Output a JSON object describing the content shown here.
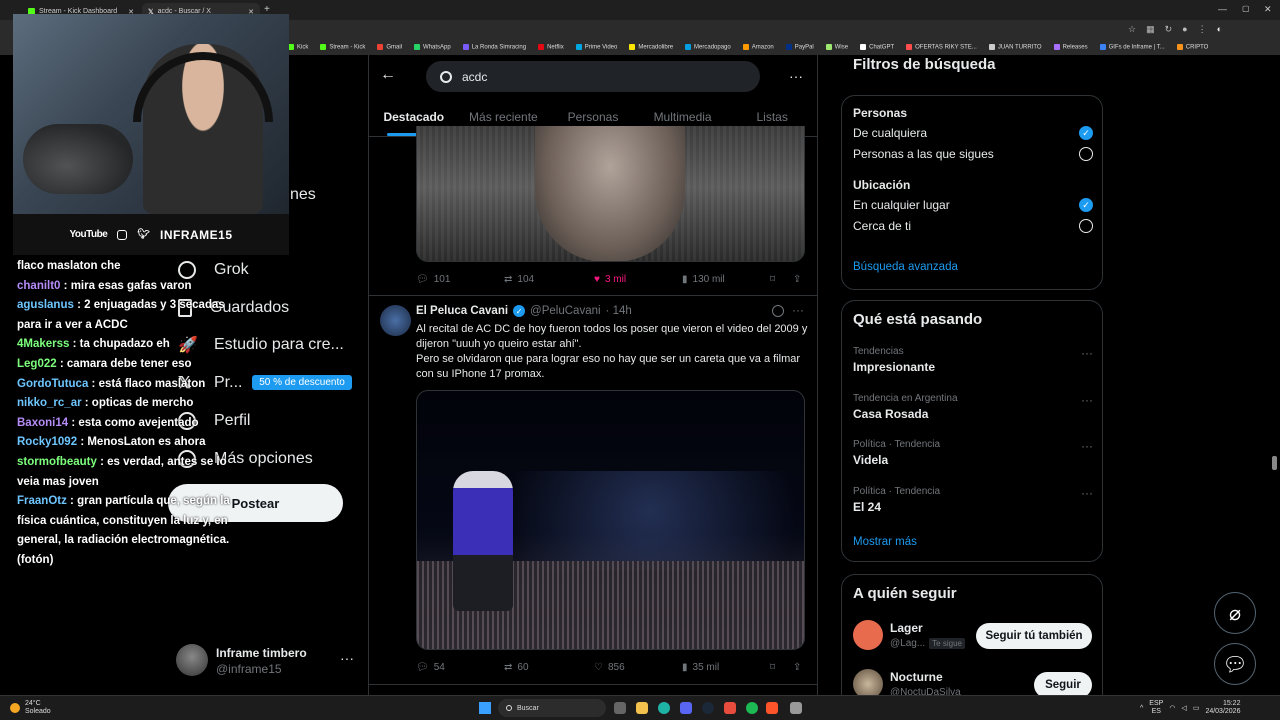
{
  "browser": {
    "tabs": [
      {
        "label": "Stream - Kick Dashboard",
        "icon": "kick-icon"
      },
      {
        "label": "acdc - Buscar / X",
        "icon": "x-icon"
      }
    ],
    "bookmarks": [
      {
        "label": "Kick",
        "color": "#53fc18"
      },
      {
        "label": "Stream - Kick",
        "color": "#53fc18"
      },
      {
        "label": "Gmail",
        "color": "#ea4335"
      },
      {
        "label": "WhatsApp",
        "color": "#25d366"
      },
      {
        "label": "La Ronda Simracing",
        "color": "#7a5af8"
      },
      {
        "label": "Netflix",
        "color": "#e50914"
      },
      {
        "label": "Prime Video",
        "color": "#00a8e1"
      },
      {
        "label": "Mercadolibre",
        "color": "#ffe600"
      },
      {
        "label": "Mercadopago",
        "color": "#009ee3"
      },
      {
        "label": "Amazon",
        "color": "#ff9900"
      },
      {
        "label": "PayPal",
        "color": "#003087"
      },
      {
        "label": "Wise",
        "color": "#9fe870"
      },
      {
        "label": "ChatGPT",
        "color": "#ffffff"
      },
      {
        "label": "OFERTAS RIKY STE...",
        "color": "#ff4d4d"
      },
      {
        "label": "JUAN TURRITO",
        "color": "#cccccc"
      },
      {
        "label": "Releases",
        "color": "#a970ff"
      },
      {
        "label": "GIFs de Inframe | T...",
        "color": "#3b82f6"
      },
      {
        "label": "CRIPTO",
        "color": "#f7931a"
      }
    ]
  },
  "webcam": {
    "brand_youtube": "YouTube",
    "channel_name": "INFRAME15"
  },
  "chat": [
    {
      "user": "",
      "msg": "flaco maslaton che",
      "color": "#ffffff"
    },
    {
      "user": "chanilt0",
      "msg": ": mira esas gafas varon",
      "color": "#b58cf8"
    },
    {
      "user": "aguslanus",
      "msg": ": 2 enjuagadas y 3 secadas para ir a ver a ACDC",
      "color": "#6ec6ff"
    },
    {
      "user": "4Makerss",
      "msg": ": ta chupadazo eh",
      "color": "#7dff7d"
    },
    {
      "user": "Leg022",
      "msg": ": camara debe tener eso",
      "color": "#7dff7d"
    },
    {
      "user": "GordoTutuca",
      "msg": ": está flaco maslaton",
      "color": "#6ec6ff"
    },
    {
      "user": "nikko_rc_ar",
      "msg": ": opticas de mercho",
      "color": "#6ec6ff"
    },
    {
      "user": "Baxoni14",
      "msg": ": esta como avejentado",
      "color": "#b58cf8"
    },
    {
      "user": "Rocky1092",
      "msg": ": MenosLaton es ahora",
      "color": "#6ec6ff"
    },
    {
      "user": "stormofbeauty",
      "msg": ": es verdad, antes se lo veia mas joven",
      "color": "#7dff7d"
    },
    {
      "user": "FraanOtz",
      "msg": ": gran partícula que, según la física cuántica, constituyen la luz y, en general, la radiación electromagnética. (fotón)",
      "color": "#6ec6ff"
    }
  ],
  "nav": {
    "partial_label": "nes",
    "items": [
      {
        "label": "Grok",
        "icon": "grok-icon"
      },
      {
        "label": "Guardados",
        "icon": "bookmark-icon"
      },
      {
        "label": "Estudio para cre...",
        "icon": "rocket-icon"
      },
      {
        "label": "Pr...",
        "icon": "x-logo-icon"
      },
      {
        "label": "Perfil",
        "icon": "person-icon"
      },
      {
        "label": "Más opciones",
        "icon": "more-circle-icon"
      }
    ],
    "promo_badge": "50 % de descuento",
    "post_button": "Postear",
    "account_name": "Inframe timbero",
    "account_handle": "@inframe15"
  },
  "search": {
    "query": "acdc",
    "tabs": [
      "Destacado",
      "Más reciente",
      "Personas",
      "Multimedia",
      "Listas"
    ],
    "active_tab": "Destacado"
  },
  "tweet1": {
    "replies": "101",
    "retweets": "104",
    "likes": "3 mil",
    "views": "130 mil"
  },
  "tweet2": {
    "name": "El Peluca Cavani",
    "handle": "@PeluCavani",
    "time": "· 14h",
    "text": "Al recital de AC DC de hoy fueron todos los poser que vieron el video del 2009 y dijeron \"uuuh yo queiro estar ahí\".\nPero se olvidaron que para lograr eso no hay que ser un careta que va a filmar con su IPhone 17 promax.",
    "replies": "54",
    "retweets": "60",
    "likes": "856",
    "views": "35 mil"
  },
  "filters": {
    "title": "Filtros de búsqueda",
    "people_heading": "Personas",
    "people_opt1": "De cualquiera",
    "people_opt2": "Personas a las que sigues",
    "location_heading": "Ubicación",
    "location_opt1": "En cualquier lugar",
    "location_opt2": "Cerca de ti",
    "advanced": "Búsqueda avanzada"
  },
  "trends": {
    "title": "Qué está pasando",
    "items": [
      {
        "meta": "Tendencias",
        "name": "Impresionante"
      },
      {
        "meta": "Tendencia en Argentina",
        "name": "Casa Rosada"
      },
      {
        "meta": "Política · Tendencia",
        "name": "Videla"
      },
      {
        "meta": "Política · Tendencia",
        "name": "El 24"
      }
    ],
    "show_more": "Mostrar más"
  },
  "who_to_follow": {
    "title": "A quién seguir",
    "items": [
      {
        "name": "Lager",
        "handle": "@Lag...",
        "badge": "Te sigue",
        "button": "Seguir tú también"
      },
      {
        "name": "Nocturne",
        "handle": "@NoctuDaSilva",
        "badge": "",
        "button": "Seguir"
      }
    ]
  },
  "taskbar": {
    "weather_temp": "24°C",
    "weather_desc": "Soleado",
    "search_placeholder": "Buscar",
    "lang1": "ESP",
    "lang2": "ES",
    "time": "15:22",
    "date": "24/03/2026"
  },
  "colors": {
    "accent": "#1d9bf0",
    "like": "#f91880",
    "background": "#000000"
  }
}
